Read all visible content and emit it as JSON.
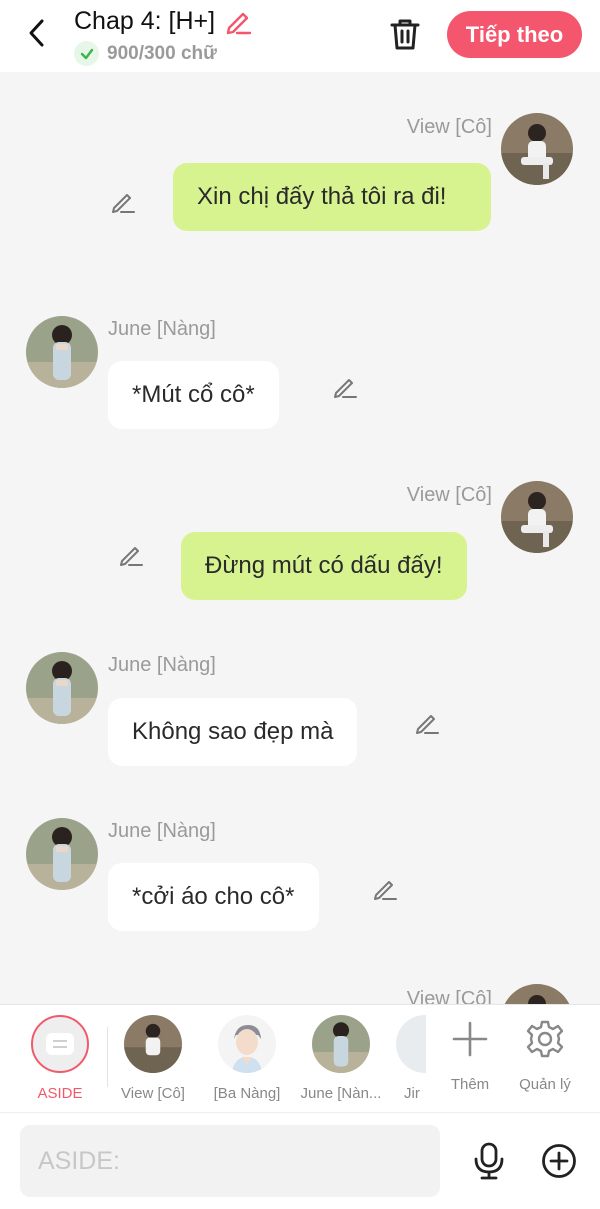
{
  "header": {
    "title": "Chap 4: [H+]",
    "word_count": "900/300 chữ",
    "next_label": "Tiếp theo"
  },
  "colors": {
    "accent": "#f4566e",
    "bubble_self": "#d7f38f",
    "bubble_other": "#ffffff",
    "background": "#f5f5f5"
  },
  "messages": [
    {
      "sender": "View [Cô]",
      "text": "Xin chị đấy thả tôi ra đi!",
      "side": "right"
    },
    {
      "sender": "June [Nàng]",
      "text": "*Mút cổ cô*",
      "side": "left"
    },
    {
      "sender": "View [Cô]",
      "text": "Đừng mút có dấu đấy!",
      "side": "right"
    },
    {
      "sender": "June [Nàng]",
      "text": "Không sao đẹp mà",
      "side": "left"
    },
    {
      "sender": "June [Nàng]",
      "text": "*cởi áo cho cô*",
      "side": "left"
    },
    {
      "sender": "View [Cô]",
      "text": "",
      "side": "right"
    }
  ],
  "characters": [
    {
      "label": "ASIDE",
      "selected": true
    },
    {
      "label": "View [Cô]"
    },
    {
      "label": "[Ba Nàng]"
    },
    {
      "label": "June [Nàn..."
    },
    {
      "label": "Jir"
    }
  ],
  "tools": [
    {
      "label": "Thêm",
      "icon": "plus-icon"
    },
    {
      "label": "Quản lý",
      "icon": "gear-icon"
    }
  ],
  "input": {
    "placeholder": "ASIDE:"
  }
}
